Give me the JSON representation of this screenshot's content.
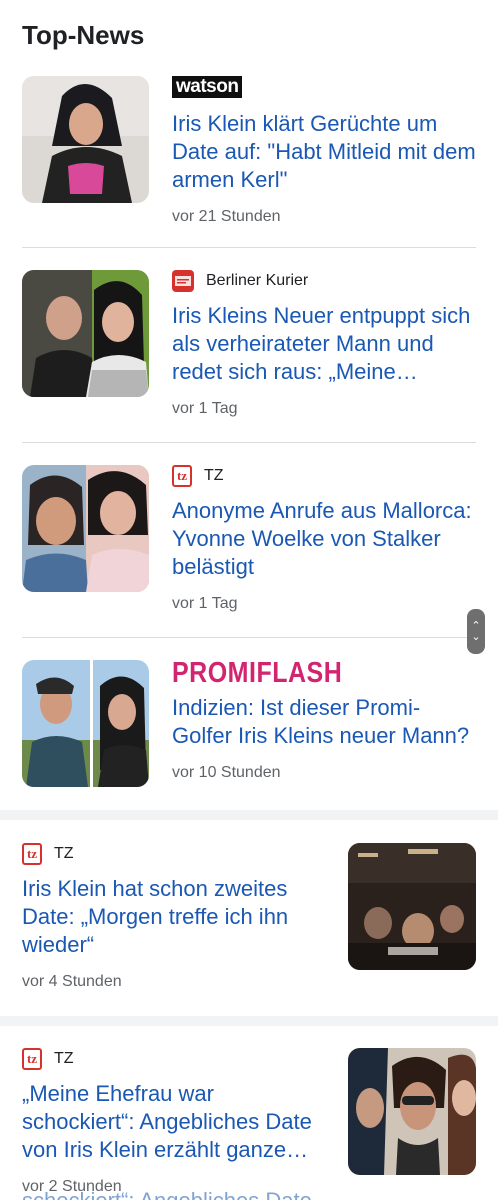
{
  "section": {
    "title": "Top-News"
  },
  "articles": [
    {
      "source": "watson",
      "headline": "Iris Klein klärt Gerüchte um Date auf: \"Habt Mitleid mit dem armen Kerl\"",
      "time": "vor 21 Stunden"
    },
    {
      "source": "Berliner Kurier",
      "headline": "Iris Kleins Neuer entpuppt sich als verheirateter Mann und redet sich raus: „Meine…",
      "time": "vor 1 Tag"
    },
    {
      "source": "TZ",
      "headline": "Anonyme Anrufe aus Mallorca: Yvonne Woelke von Stalker belästigt",
      "time": "vor 1 Tag"
    },
    {
      "source": "PROMIFLASH",
      "headline": "Indizien: Ist dieser Promi-Golfer Iris Kleins neuer Mann?",
      "time": "vor 10 Stunden"
    }
  ],
  "cards": [
    {
      "source": "TZ",
      "headline": "Iris Klein hat schon zweites Date: „Morgen treffe ich ihn wieder“",
      "time": "vor 4 Stunden"
    },
    {
      "source": "TZ",
      "headline": "„Meine Ehefrau war schockiert“: Angebliches Date von Iris Klein erzählt ganze…",
      "time": "vor 2 Stunden"
    }
  ],
  "peek_text": "schockiert“: Angebliches Date",
  "icons": {
    "scroll_up": "chevron-up-icon",
    "scroll_down": "chevron-down-icon"
  },
  "colors": {
    "headline": "#1a58b3",
    "tz": "#d6322d",
    "promiflash": "#d2246f"
  }
}
